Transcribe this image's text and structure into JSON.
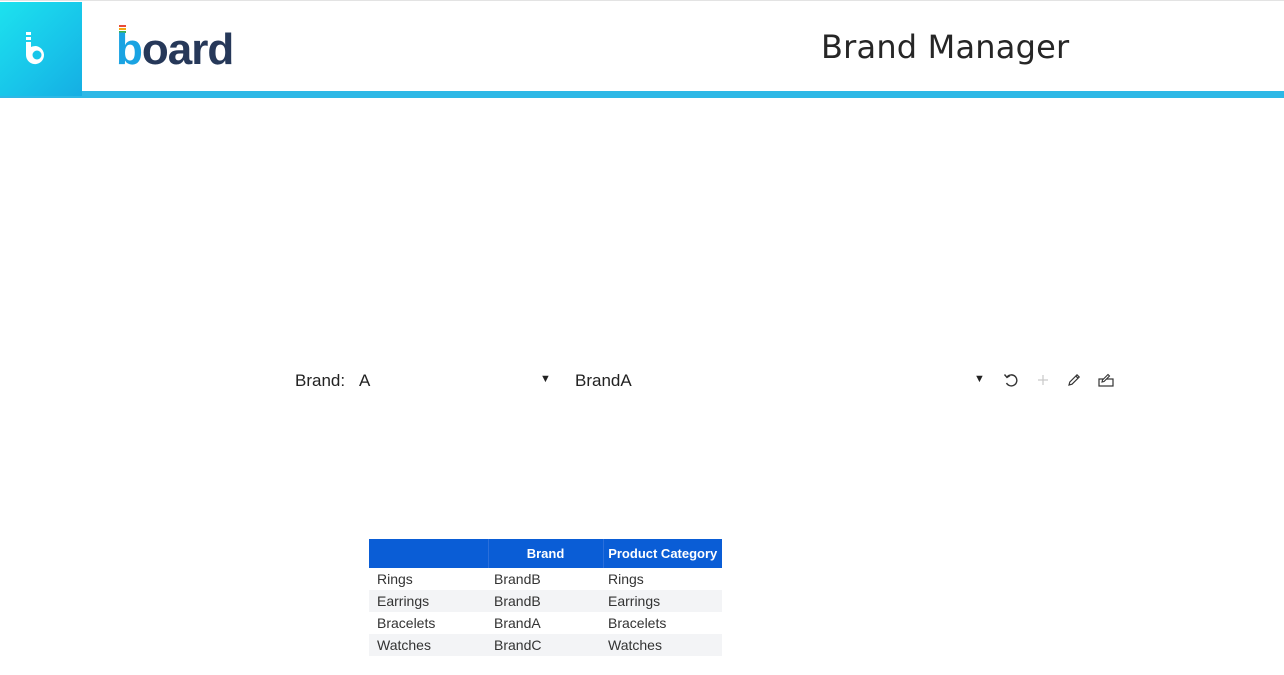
{
  "header": {
    "logo_text": "board",
    "title": "Brand Manager",
    "home_icon": "board-b-icon",
    "colors": {
      "tile": "#18c6ea",
      "bar": "#2db8e6",
      "logo_dark": "#263859",
      "logo_accent": "#1aa3e2"
    }
  },
  "filter": {
    "label": "Brand:",
    "brand_value": "A",
    "item_value": "BrandA",
    "dropdown_arrow": "▼"
  },
  "toolbar": {
    "icons": [
      "undo-icon",
      "add-icon",
      "edit-icon",
      "bulk-edit-icon"
    ]
  },
  "table": {
    "header_color": "#0a5dd6",
    "columns": [
      "",
      "Brand",
      "Product Category"
    ],
    "rows": [
      [
        "Rings",
        "BrandB",
        "Rings"
      ],
      [
        "Earrings",
        "BrandB",
        "Earrings"
      ],
      [
        "Bracelets",
        "BrandA",
        "Bracelets"
      ],
      [
        "Watches",
        "BrandC",
        "Watches"
      ]
    ]
  }
}
